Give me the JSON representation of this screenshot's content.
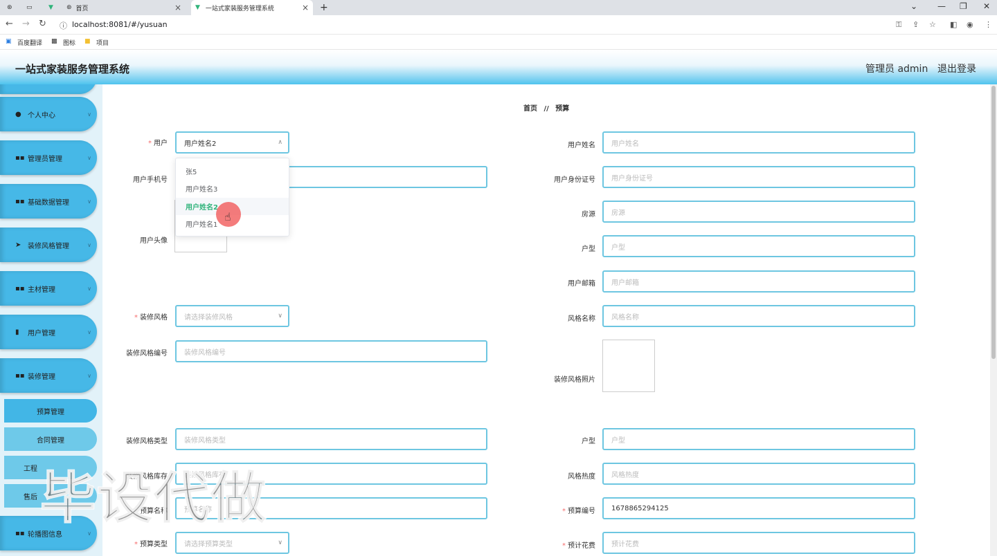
{
  "browser": {
    "tabs": [
      {
        "title": "首页"
      },
      {
        "title": "一站式家装服务管理系统"
      }
    ],
    "url": "localhost:8081/#/yusuan",
    "bookmarks": [
      "百度翻译",
      "图标",
      "项目"
    ]
  },
  "header": {
    "title": "一站式家装服务管理系统",
    "user": "管理员 admin",
    "logout": "退出登录"
  },
  "sidebar": {
    "menus": [
      {
        "label": "个人中心",
        "icon": "person-icon"
      },
      {
        "label": "管理员管理",
        "icon": "grid-icon"
      },
      {
        "label": "基础数据管理",
        "icon": "grid-icon"
      },
      {
        "label": "装修风格管理",
        "icon": "send-icon"
      },
      {
        "label": "主材管理",
        "icon": "grid-icon"
      },
      {
        "label": "用户管理",
        "icon": "clipboard-icon"
      },
      {
        "label": "装修管理",
        "icon": "grid-icon"
      },
      {
        "label": "轮播图信息",
        "icon": "grid-icon"
      }
    ],
    "submenus": [
      "预算管理",
      "合同管理",
      "工程",
      "售后"
    ]
  },
  "breadcrumb": {
    "home": "首页",
    "sep": "//",
    "current": "预算"
  },
  "form": {
    "user": {
      "label": "用户",
      "value": "用户姓名2"
    },
    "user_name": {
      "label": "用户姓名",
      "placeholder": "用户姓名"
    },
    "user_phone": {
      "label": "用户手机号"
    },
    "user_idcard": {
      "label": "用户身份证号",
      "placeholder": "用户身份证号"
    },
    "house_source": {
      "label": "房源",
      "placeholder": "房源"
    },
    "user_avatar": {
      "label": "用户头像"
    },
    "house_type": {
      "label": "户型",
      "placeholder": "户型"
    },
    "user_email": {
      "label": "用户邮箱",
      "placeholder": "用户邮箱"
    },
    "style": {
      "label": "装修风格",
      "placeholder": "请选择装修风格"
    },
    "style_name": {
      "label": "风格名称",
      "placeholder": "风格名称"
    },
    "style_code": {
      "label": "装修风格编号",
      "placeholder": "装修风格编号"
    },
    "style_photo": {
      "label": "装修风格照片"
    },
    "style_type": {
      "label": "装修风格类型",
      "placeholder": "装修风格类型"
    },
    "house_type2": {
      "label": "户型",
      "placeholder": "户型"
    },
    "style_stock": {
      "label": "装修风格库存",
      "placeholder": "装修风格库存"
    },
    "style_heat": {
      "label": "风格热度",
      "placeholder": "风格热度"
    },
    "budget_name": {
      "label": "预算名称",
      "placeholder": "预算名称"
    },
    "budget_no": {
      "label": "预算编号",
      "value": "1678865294125"
    },
    "budget_type": {
      "label": "预算类型",
      "placeholder": "请选择预算类型"
    },
    "budget_cost": {
      "label": "预计花费",
      "placeholder": "预计花费"
    }
  },
  "dropdown": {
    "options": [
      "张5",
      "用户姓名3",
      "用户姓名2",
      "用户姓名1"
    ]
  },
  "watermark": "毕设代做"
}
